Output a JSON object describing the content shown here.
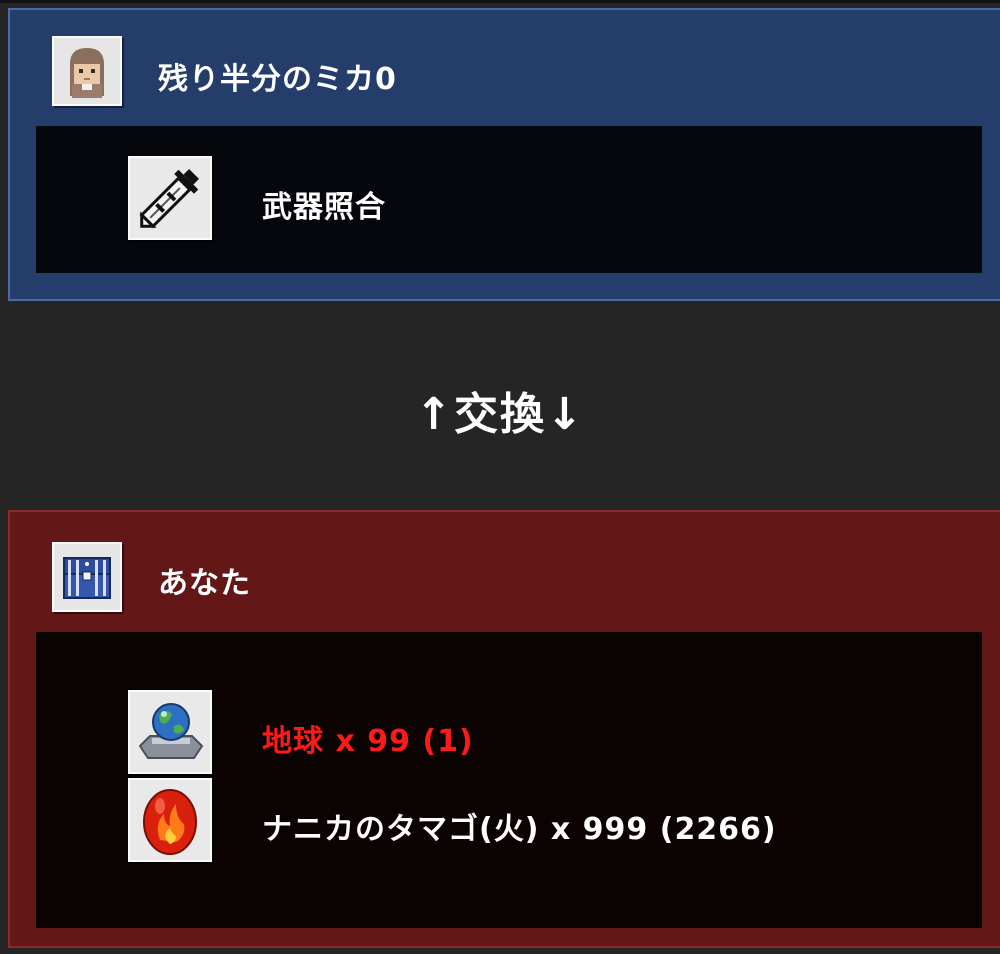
{
  "partner": {
    "name": "残り半分のミカ0",
    "icon": "girl-portrait-icon",
    "items": [
      {
        "label": "武器照合",
        "icon": "sword-icon",
        "color": "#ffffff"
      }
    ]
  },
  "exchange_label": "↑交換↓",
  "you": {
    "name": "あなた",
    "icon": "treasure-chest-icon",
    "items": [
      {
        "label": "地球 x 99 (1)",
        "icon": "earth-globe-icon",
        "color": "#ff1a1a"
      },
      {
        "label": "ナニカのタマゴ(火) x 999 (2266)",
        "icon": "fire-egg-icon",
        "color": "#ffffff"
      }
    ]
  },
  "colors": {
    "background": "#252525",
    "partner_panel": "#253d6b",
    "you_panel": "#641717",
    "warning_text": "#ff1a1a"
  }
}
